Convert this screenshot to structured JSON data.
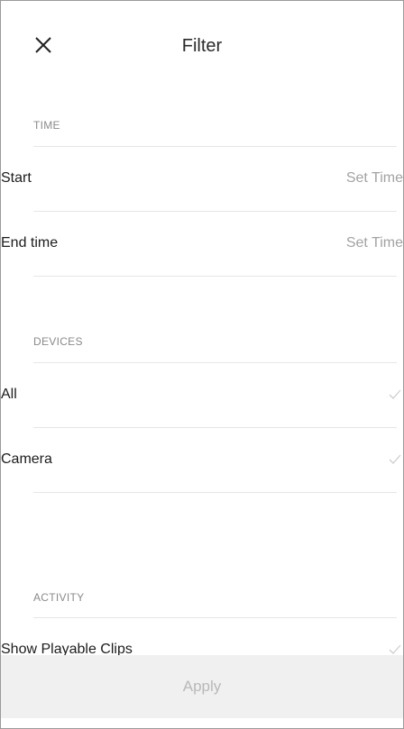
{
  "header": {
    "title": "Filter",
    "close_icon": "close-icon"
  },
  "sections": {
    "time": {
      "label": "TIME",
      "start": {
        "label": "Start",
        "value": "Set Time"
      },
      "end": {
        "label": "End time",
        "value": "Set Time"
      }
    },
    "devices": {
      "label": "DEVICES",
      "all": {
        "label": "All",
        "icon": "check-icon"
      },
      "camera": {
        "label": "Camera",
        "icon": "check-icon"
      }
    },
    "activity": {
      "label": "ACTIVITY",
      "playable": {
        "label": "Show Playable Clips",
        "icon": "check-icon"
      }
    }
  },
  "footer": {
    "apply_label": "Apply"
  },
  "colors": {
    "divider": "#e6e6e6",
    "muted_text": "#a3a3a3",
    "section_label": "#8a8a8a",
    "apply_bar": "#f0f0f0",
    "apply_text": "#b8b8b8",
    "check": "#cfcfcf"
  }
}
